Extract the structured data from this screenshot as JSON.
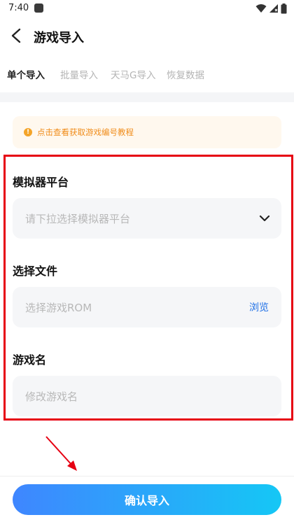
{
  "status_bar": {
    "time": "7:40",
    "icons": [
      "wifi-icon",
      "signal-icon",
      "battery-icon"
    ]
  },
  "header": {
    "back_icon": "chevron-left-icon",
    "title": "游戏导入"
  },
  "tabs": [
    {
      "label": "单个导入",
      "active": true
    },
    {
      "label": "批量导入",
      "active": false
    },
    {
      "label": "天马G导入",
      "active": false
    },
    {
      "label": "恢复数据",
      "active": false
    }
  ],
  "notice": {
    "icon": "info-icon",
    "text": "点击查看获取游戏编号教程"
  },
  "form": {
    "platform": {
      "label": "模拟器平台",
      "placeholder": "请下拉选择模拟器平台",
      "icon": "chevron-down-icon"
    },
    "file": {
      "label": "选择文件",
      "placeholder": "选择游戏ROM",
      "browse_label": "浏览"
    },
    "game_name": {
      "label": "游戏名",
      "placeholder": "修改游戏名"
    }
  },
  "confirm_button": {
    "label": "确认导入"
  },
  "colors": {
    "accent_blue": "#1e6fe6",
    "notice_orange": "#f08c1a",
    "highlight_red": "#e60012",
    "button_gradient_start": "#3f86ff",
    "button_gradient_end": "#15c7f5"
  }
}
